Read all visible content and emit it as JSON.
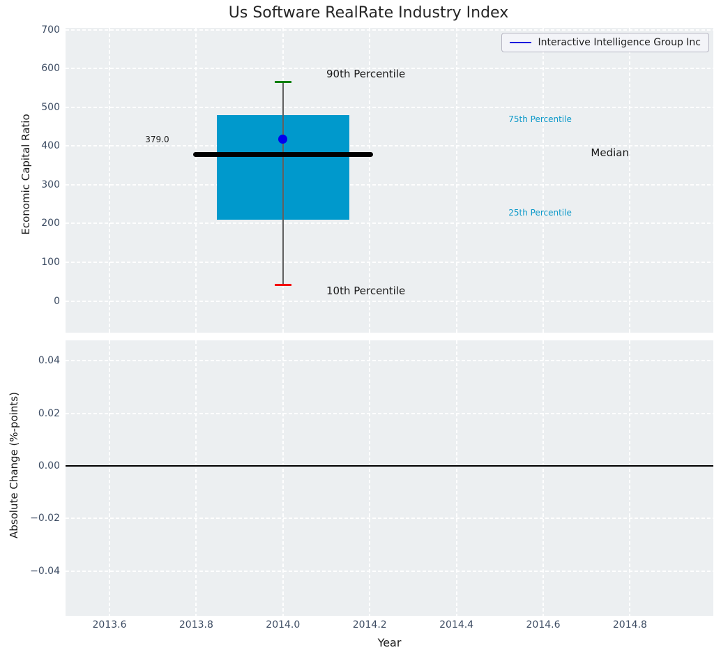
{
  "title": "Us Software RealRate Industry Index",
  "chart_data": [
    {
      "panel": "industry-index",
      "type": "boxplot",
      "title": "Us Software RealRate Industry Index",
      "ylabel": "Economic Capital Ratio",
      "yticks": [
        0,
        100,
        200,
        300,
        400,
        500,
        600,
        700
      ],
      "ylim": [
        -82,
        706
      ],
      "xlim": [
        2013.5,
        2014.99
      ],
      "grid": "white dashed",
      "x_year": 2014.0,
      "percentiles": {
        "p10": 41,
        "p25": 210,
        "median": 379,
        "p75": 480,
        "p90": 565
      },
      "median_value_label": "379.0",
      "box_width_years": 0.305,
      "median_width_years": 0.415,
      "company_point": {
        "label": "Interactive Intelligence Group Inc",
        "x": 2014.0,
        "y": 418
      },
      "legend": {
        "loc": "upper right",
        "label": "Interactive Intelligence Group Inc"
      },
      "annotations": [
        {
          "name": "annotation-90th-percentile",
          "text": "90th Percentile",
          "x": 2014.1,
          "y": 587,
          "color": "#1a1a1a",
          "size": 15,
          "ha": "left"
        },
        {
          "name": "annotation-10th-percentile",
          "text": "10th Percentile",
          "x": 2014.1,
          "y": 26,
          "color": "#1a1a1a",
          "size": 15,
          "ha": "left"
        },
        {
          "name": "annotation-75th-percentile",
          "text": "75th Percentile",
          "x": 2014.52,
          "y": 469,
          "color": "#0c99c9",
          "size": 12,
          "ha": "left"
        },
        {
          "name": "annotation-median",
          "text": "Median",
          "x": 2014.71,
          "y": 382,
          "color": "#1a1a1a",
          "size": 15,
          "ha": "left"
        },
        {
          "name": "annotation-25th-percentile",
          "text": "25th Percentile",
          "x": 2014.52,
          "y": 227,
          "color": "#0c99c9",
          "size": 12,
          "ha": "left"
        },
        {
          "name": "annotation-median-value",
          "text": "379.0",
          "x": 2013.71,
          "y": 417,
          "color": "#1a1a1a",
          "size": 12,
          "ha": "center"
        }
      ],
      "colors": {
        "box": "#0099cc",
        "median": "#000000",
        "whisker": "#606060",
        "cap_upper": "#008000",
        "cap_lower": "#f40000",
        "point": "#0000ee",
        "legend_line": "#0000dd",
        "axes_background": "#eceff1",
        "tick_label": "#3d4c63"
      }
    },
    {
      "panel": "absolute-change",
      "type": "line",
      "ylabel": "Absolute Change (%-points)",
      "xlabel": "Year",
      "yticks": [
        {
          "v": 0.04,
          "label": "0.04"
        },
        {
          "v": 0.02,
          "label": "0.02"
        },
        {
          "v": 0,
          "label": "0.00"
        },
        {
          "v": -0.02,
          "label": "−0.02"
        },
        {
          "v": -0.04,
          "label": "−0.04"
        }
      ],
      "xticks": [
        {
          "v": 2013.6,
          "label": "2013.6"
        },
        {
          "v": 2013.8,
          "label": "2013.8"
        },
        {
          "v": 2014.0,
          "label": "2014.0"
        },
        {
          "v": 2014.2,
          "label": "2014.2"
        },
        {
          "v": 2014.4,
          "label": "2014.4"
        },
        {
          "v": 2014.6,
          "label": "2014.6"
        },
        {
          "v": 2014.8,
          "label": "2014.8"
        }
      ],
      "ylim": [
        -0.057,
        0.048
      ],
      "xlim": [
        2013.5,
        2014.99
      ],
      "zero_line": 0.0,
      "series": []
    }
  ]
}
